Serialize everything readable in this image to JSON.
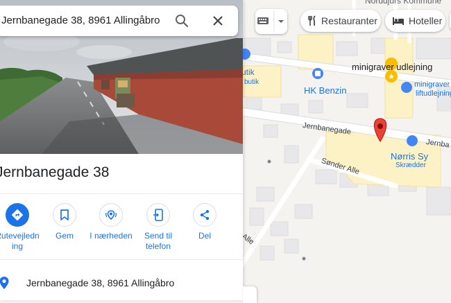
{
  "search": {
    "query": "Jernbanegade 38, 8961 Allingåbro"
  },
  "place": {
    "title": "Jernbanegade 38"
  },
  "actions": [
    {
      "label": "Rutevejledning"
    },
    {
      "label": "Gem"
    },
    {
      "label": "I nærheden"
    },
    {
      "label": "Send til telefon"
    },
    {
      "label": "Del"
    }
  ],
  "address": {
    "text": "Jernbanegade 38, 8961 Allingåbro"
  },
  "map": {
    "chips": [
      {
        "label": "Restauranter",
        "icon": "fork-knife-icon"
      },
      {
        "label": "Hoteller",
        "icon": "bed-icon"
      }
    ],
    "labels": {
      "top_area": "Norddjurs Kommune",
      "gas_station": "HK Benzin",
      "minigraver": "minigraver udlejning",
      "minigraver_small_1": "minigraver ud",
      "minigraver_small_2": "liftudlejning",
      "street_main": "Jernbanegade",
      "street_main_right": "Jernba",
      "store_name": "Nørris Sy",
      "store_type": "Skrædder",
      "street_sonder": "Sønder Alle",
      "butik_1": "utik",
      "butik_2": "butik",
      "alle_fragment": "Alle"
    },
    "colors": {
      "accent": "#1a73e8",
      "pin": "#ea4335",
      "poi_blue": "#4285f4",
      "poi_yellow": "#fbbc04"
    }
  }
}
